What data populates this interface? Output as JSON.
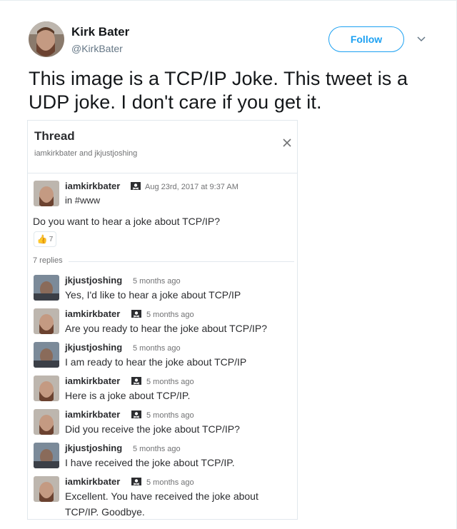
{
  "tweet": {
    "author_name": "Kirk Bater",
    "author_handle": "@KirkBater",
    "follow_label": "Follow",
    "text": "This image is a TCP/IP Joke.  This tweet is a UDP joke.  I don't care if you get it."
  },
  "thread": {
    "title": "Thread",
    "participants": "iamkirkbater and jkjustjoshing",
    "parent": {
      "user": "iamkirkbater",
      "timestamp": "Aug 23rd, 2017 at 9:37 AM",
      "channel": "in #www",
      "text": "Do you want to hear a joke about TCP/IP?",
      "reaction_count": "7"
    },
    "replies_label": "7 replies",
    "replies": [
      {
        "user": "jkjustjoshing",
        "time": "5 months ago",
        "text": "Yes, I'd like to hear a joke about TCP/IP",
        "text2": ""
      },
      {
        "user": "iamkirkbater",
        "time": "5 months ago",
        "text": "Are you ready to hear the joke about TCP/IP?",
        "text2": ""
      },
      {
        "user": "jkjustjoshing",
        "time": "5 months ago",
        "text": "I am ready to hear the joke about TCP/IP",
        "text2": ""
      },
      {
        "user": "iamkirkbater",
        "time": "5 months ago",
        "text": "Here is a joke about TCP/IP.",
        "text2": ""
      },
      {
        "user": "iamkirkbater",
        "time": "5 months ago",
        "text": "Did you receive the joke about TCP/IP?",
        "text2": ""
      },
      {
        "user": "jkjustjoshing",
        "time": "5 months ago",
        "text": "I have received the joke about TCP/IP.",
        "text2": ""
      },
      {
        "user": "iamkirkbater",
        "time": "5 months ago",
        "text": "Excellent.  You have received the joke about",
        "text2": "TCP/IP.  Goodbye."
      }
    ]
  },
  "colors": {
    "twitter_blue": "#1da1f2",
    "slack_text": "#2c2d30",
    "muted": "#717274"
  }
}
